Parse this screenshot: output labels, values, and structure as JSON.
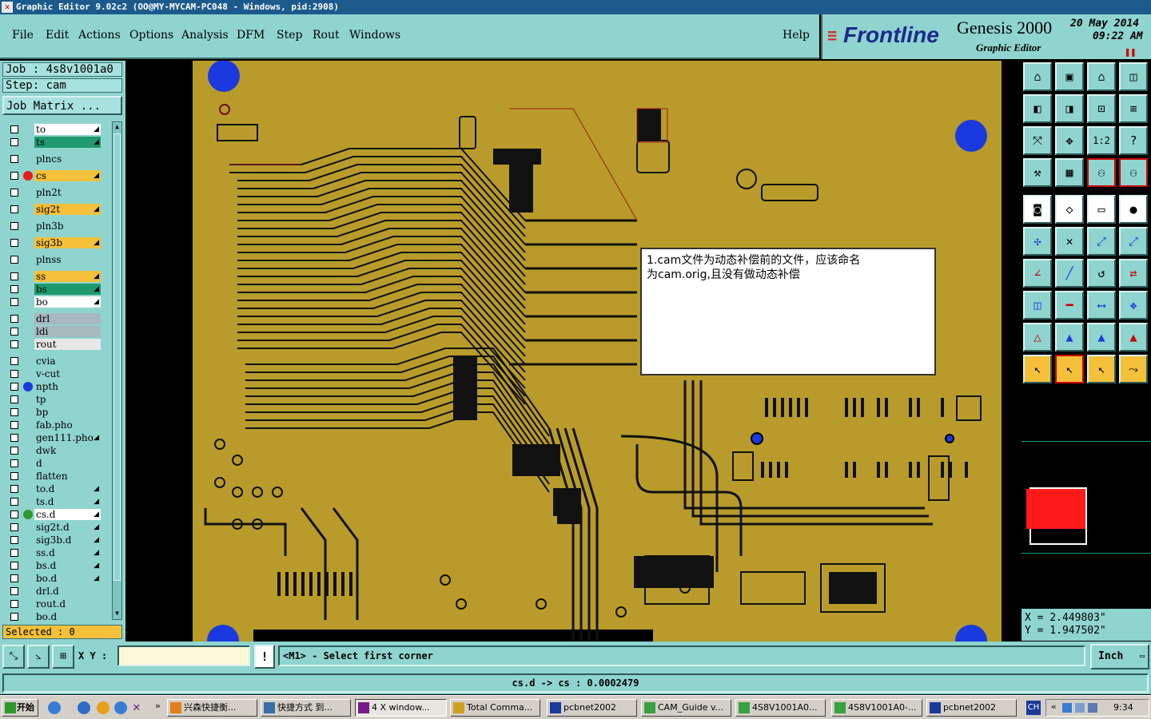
{
  "window": {
    "title": "Graphic Editor 9.02c2  (OO@MY-MYCAM-PC048 - Windows, pid:2908)"
  },
  "menu": {
    "items": [
      "File",
      "Edit",
      "Actions",
      "Options",
      "Analysis",
      "DFM",
      "Step",
      "Rout",
      "Windows"
    ],
    "help": "Help"
  },
  "brand": {
    "logo": "Frontline",
    "product": "Genesis 2000",
    "subtitle": "Graphic Editor",
    "date": "20 May 2014",
    "time": "09:22 AM"
  },
  "job": {
    "job_label": "Job : 4s8v1001a0",
    "step_label": "Step: cam",
    "matrix_button": "Job Matrix ..."
  },
  "layers": [
    {
      "name": "to",
      "bg": "#ffffff",
      "arrow": true,
      "dot": ""
    },
    {
      "name": "ts",
      "bg": "#1f9a6e",
      "arrow": true,
      "dot": ""
    },
    {
      "name": "plncs",
      "bg": "#8fd4cf",
      "arrow": false,
      "dot": ""
    },
    {
      "name": "cs",
      "bg": "#f5c13a",
      "arrow": true,
      "dot": "#e81b1b"
    },
    {
      "name": "pln2t",
      "bg": "#8fd4cf",
      "arrow": false,
      "dot": ""
    },
    {
      "name": "sig2t",
      "bg": "#f5c13a",
      "arrow": true,
      "dot": ""
    },
    {
      "name": "pln3b",
      "bg": "#8fd4cf",
      "arrow": false,
      "dot": ""
    },
    {
      "name": "sig3b",
      "bg": "#f5c13a",
      "arrow": true,
      "dot": ""
    },
    {
      "name": "plnss",
      "bg": "#8fd4cf",
      "arrow": false,
      "dot": ""
    },
    {
      "name": "ss",
      "bg": "#f5c13a",
      "arrow": true,
      "dot": ""
    },
    {
      "name": "bs",
      "bg": "#1f9a6e",
      "arrow": true,
      "dot": ""
    },
    {
      "name": "bo",
      "bg": "#ffffff",
      "arrow": true,
      "dot": ""
    },
    {
      "name": "drl",
      "bg": "#a9b8bf",
      "arrow": false,
      "dot": ""
    },
    {
      "name": "ldi",
      "bg": "#a9b8bf",
      "arrow": false,
      "dot": ""
    },
    {
      "name": "rout",
      "bg": "#e8e8e8",
      "arrow": false,
      "dot": ""
    },
    {
      "name": "cvia",
      "bg": "#8fd4cf",
      "arrow": false,
      "dot": ""
    },
    {
      "name": "v-cut",
      "bg": "#8fd4cf",
      "arrow": false,
      "dot": ""
    },
    {
      "name": "npth",
      "bg": "#8fd4cf",
      "arrow": false,
      "dot": "#1a3ae0"
    },
    {
      "name": "tp",
      "bg": "#8fd4cf",
      "arrow": false,
      "dot": ""
    },
    {
      "name": "bp",
      "bg": "#8fd4cf",
      "arrow": false,
      "dot": ""
    },
    {
      "name": "fab.pho",
      "bg": "#8fd4cf",
      "arrow": false,
      "dot": ""
    },
    {
      "name": "gen111.pho",
      "bg": "#8fd4cf",
      "arrow": true,
      "dot": ""
    },
    {
      "name": "dwk",
      "bg": "#8fd4cf",
      "arrow": false,
      "dot": ""
    },
    {
      "name": "d",
      "bg": "#8fd4cf",
      "arrow": false,
      "dot": ""
    },
    {
      "name": "flatten",
      "bg": "#8fd4cf",
      "arrow": false,
      "dot": ""
    },
    {
      "name": "to.d",
      "bg": "#8fd4cf",
      "arrow": true,
      "dot": ""
    },
    {
      "name": "ts.d",
      "bg": "#8fd4cf",
      "arrow": true,
      "dot": ""
    },
    {
      "name": "cs.d",
      "bg": "#ffffff",
      "arrow": true,
      "dot": "#2f9a2f"
    },
    {
      "name": "sig2t.d",
      "bg": "#8fd4cf",
      "arrow": true,
      "dot": ""
    },
    {
      "name": "sig3b.d",
      "bg": "#8fd4cf",
      "arrow": true,
      "dot": ""
    },
    {
      "name": "ss.d",
      "bg": "#8fd4cf",
      "arrow": true,
      "dot": ""
    },
    {
      "name": "bs.d",
      "bg": "#8fd4cf",
      "arrow": true,
      "dot": ""
    },
    {
      "name": "bo.d",
      "bg": "#8fd4cf",
      "arrow": true,
      "dot": ""
    },
    {
      "name": "drl.d",
      "bg": "#8fd4cf",
      "arrow": false,
      "dot": ""
    },
    {
      "name": "rout.d",
      "bg": "#8fd4cf",
      "arrow": false,
      "dot": ""
    },
    {
      "name": "bo.d",
      "bg": "#8fd4cf",
      "arrow": false,
      "dot": ""
    }
  ],
  "selected": "Selected : 0",
  "popup": {
    "line1": "1.cam文件为动态补偿前的文件，应该命名",
    "line2": "为cam.orig,且没有做动态补偿"
  },
  "coords": {
    "x": "X = 2.449803\"",
    "y": "Y = 1.947502\""
  },
  "command": {
    "xy_label": "X Y :",
    "xy_value": "",
    "prompt": "<M1> - Select first corner",
    "unit": "Inch"
  },
  "status": "cs.d -> cs : 0.0002479",
  "taskbar": {
    "start": "开始",
    "tasks": [
      "兴森快捷衡...",
      "快捷方式 到...",
      "4 X window...",
      "Total Comma...",
      "pcbnet2002",
      "CAM_Guide v...",
      "4S8V1001A0...",
      "4S8V1001A0-...",
      "pcbnet2002"
    ],
    "lang": "CH",
    "clock": "9:34"
  },
  "colors": {
    "ui": "#8fd4cf",
    "board": "#b89b2a",
    "active": "#f5c13a"
  }
}
